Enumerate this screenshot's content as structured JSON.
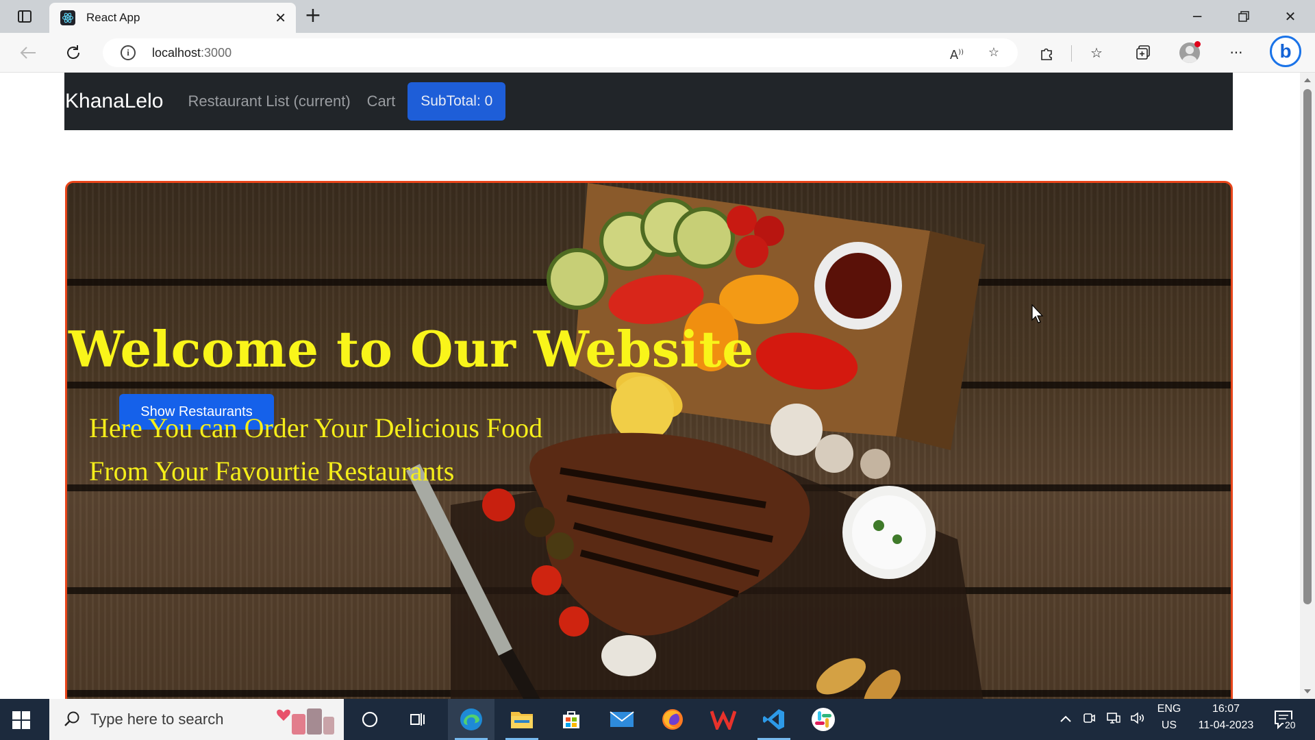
{
  "browser": {
    "tab_title": "React App",
    "url_host": "localhost",
    "url_port": ":3000"
  },
  "site": {
    "brand": "KhanaLelo",
    "nav_restaurant_list": "Restaurant List (current)",
    "nav_cart": "Cart",
    "subtotal_label": "SubTotal: 0"
  },
  "hero": {
    "title": "Welcome to Our Website",
    "button_label": "Show Restaurants",
    "subtitle_line1": "Here You can Order Your Delicious Food",
    "subtitle_line2": "From Your Favourtie Restaurants"
  },
  "taskbar": {
    "search_placeholder": "Type here to search",
    "lang_line1": "ENG",
    "lang_line2": "US",
    "time": "16:07",
    "date": "11-04-2023",
    "notification_count": "20"
  },
  "colors": {
    "navbar_bg": "#212529",
    "subtotal_btn": "#1e5ed8",
    "hero_border": "#e8451a",
    "hero_text": "#f9f51a",
    "hero_button": "#1561ea"
  },
  "icons": [
    "sidebar-toggle-icon",
    "react-favicon",
    "close-icon",
    "plus-icon",
    "minimize-icon",
    "restore-icon",
    "back-arrow-icon",
    "refresh-icon",
    "info-icon",
    "read-aloud-icon",
    "add-favorite-icon",
    "extensions-icon",
    "favorites-icon",
    "collections-icon",
    "more-icon",
    "bing-icon",
    "windows-logo-icon",
    "search-icon",
    "cortana-icon",
    "task-view-icon",
    "edge-icon",
    "file-explorer-icon",
    "store-icon",
    "mail-icon",
    "firefox-icon",
    "wps-icon",
    "vscode-icon",
    "slack-icon",
    "chevron-up-icon",
    "meet-icon",
    "network-icon",
    "volume-icon",
    "notification-icon"
  ]
}
